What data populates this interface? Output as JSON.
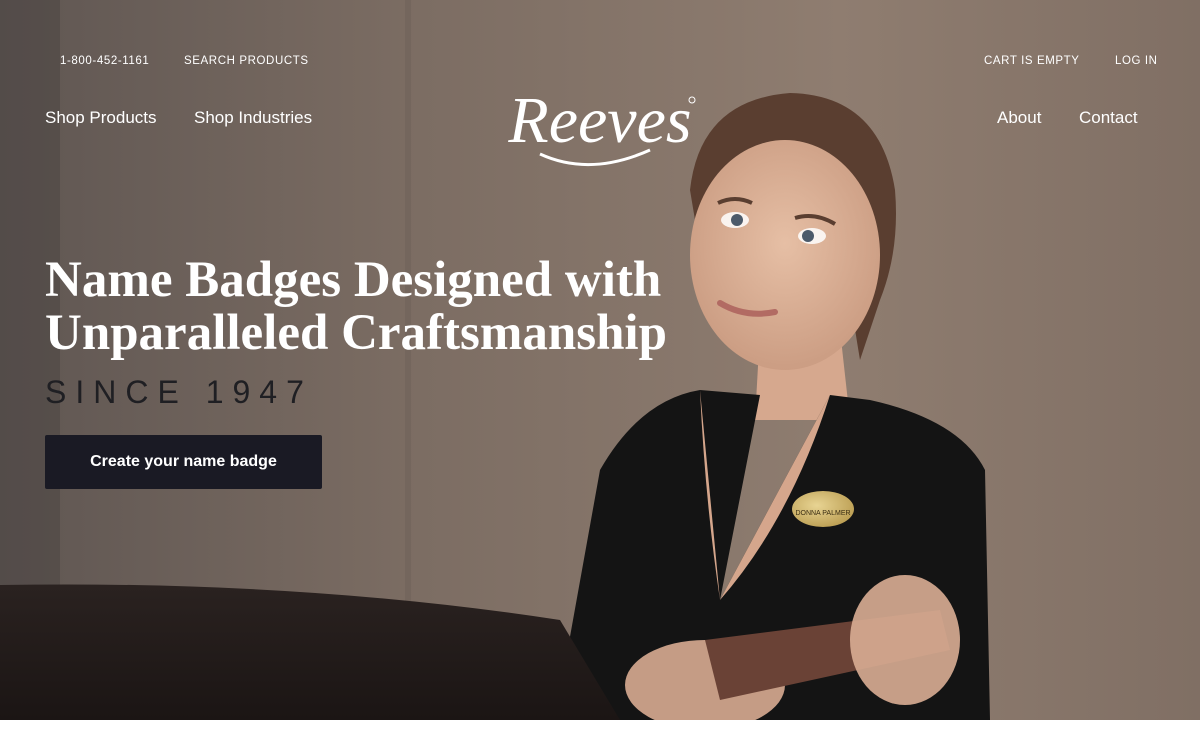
{
  "utility_nav": {
    "phone": "1-800-452-1161",
    "search_products": "SEARCH PRODUCTS",
    "cart": "CART IS EMPTY",
    "login": "LOG IN"
  },
  "main_nav": {
    "shop_products": "Shop Products",
    "shop_industries": "Shop Industries",
    "about": "About",
    "contact": "Contact"
  },
  "brand": {
    "logo_text": "Reeves",
    "logo_icon": "reeves-script-wordmark"
  },
  "hero": {
    "headline_line1": "Name Badges Designed with",
    "headline_line2": "Unparalleled Craftsmanship",
    "since": "SINCE 1947",
    "cta_label": "Create your name badge",
    "badge_name": "DONNA PALMER",
    "photo_icon": "hotel-receptionist-photo"
  },
  "colors": {
    "cta_background": "#1a1a24",
    "nav_text": "#ffffff",
    "since_text": "#1f1f23"
  }
}
